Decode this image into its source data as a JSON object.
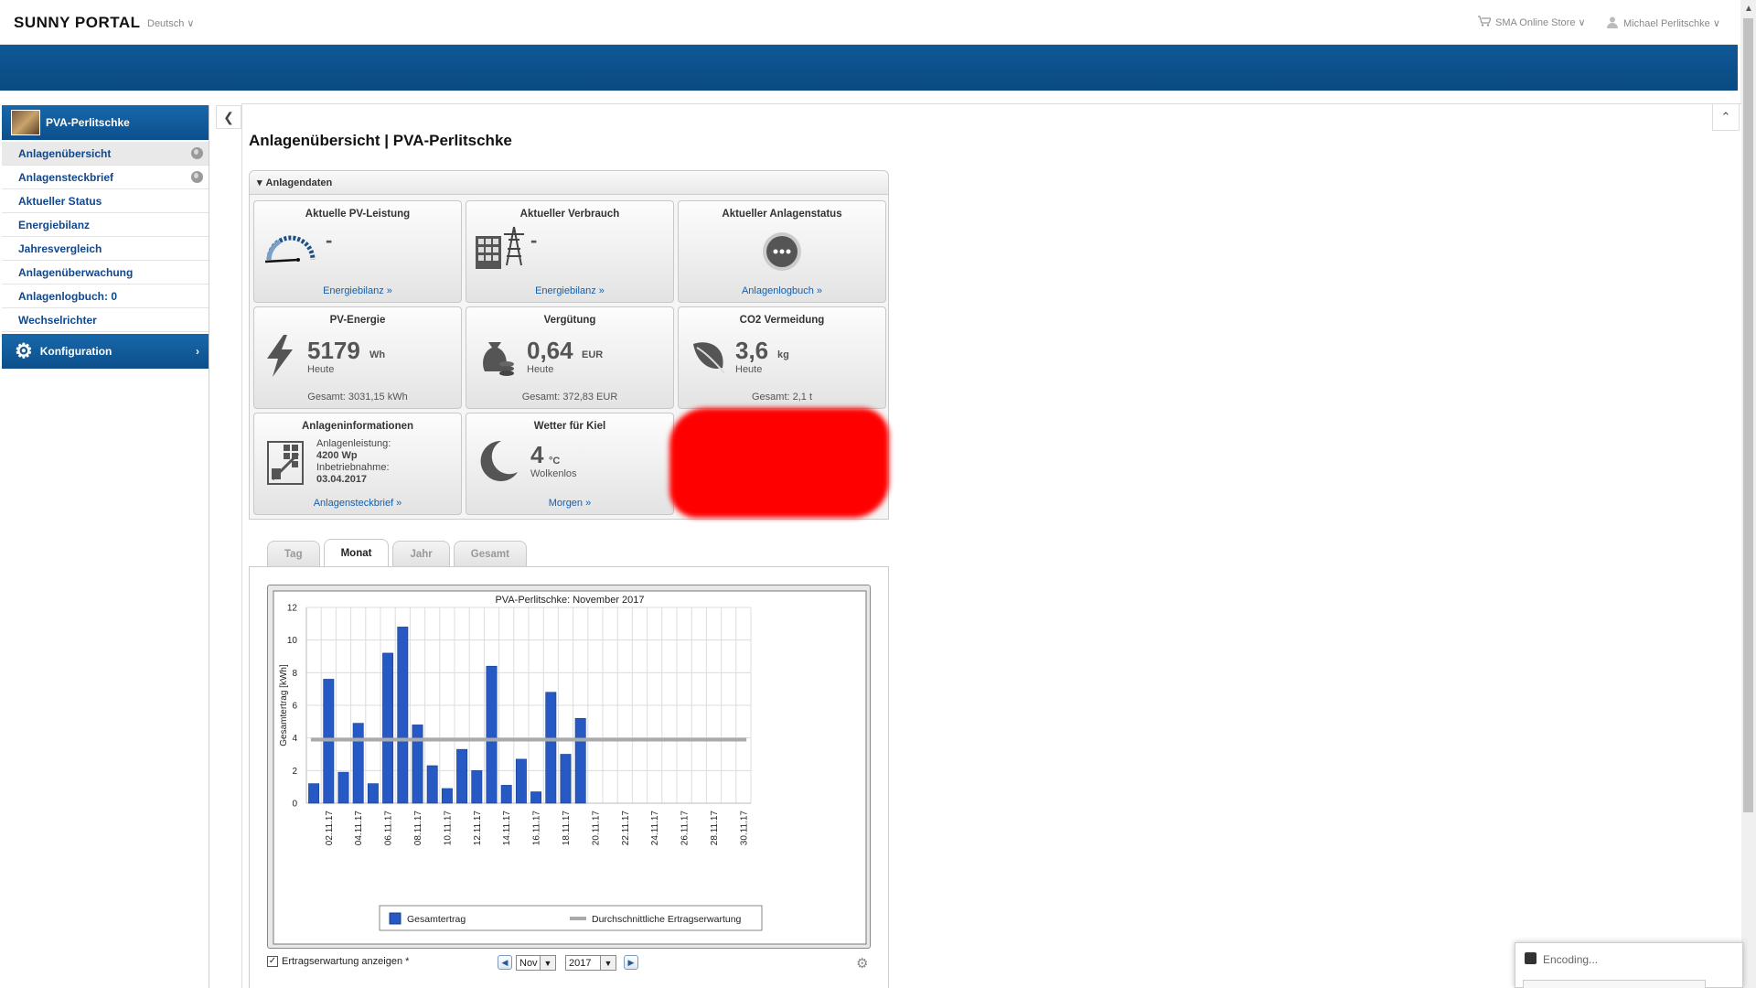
{
  "header": {
    "logo": "SUNNY PORTAL",
    "language": "Deutsch ∨",
    "store": "SMA Online Store ∨",
    "user": "Michael Perlitschke ∨"
  },
  "sidebar": {
    "plant_name": "PVA-Perlitschke",
    "items": [
      {
        "label": "Anlagenübersicht",
        "globe": true
      },
      {
        "label": "Anlagensteckbrief",
        "globe": true
      },
      {
        "label": "Aktueller Status",
        "globe": false
      },
      {
        "label": "Energiebilanz",
        "globe": false
      },
      {
        "label": "Jahresvergleich",
        "globe": false
      },
      {
        "label": "Anlagenüberwachung",
        "globe": false
      },
      {
        "label": "Anlagenlogbuch: 0",
        "globe": false
      },
      {
        "label": "Wechselrichter",
        "globe": false
      }
    ],
    "config_label": "Konfiguration",
    "config_chevron": "›"
  },
  "main": {
    "title": "Anlagenübersicht | PVA-Perlitschke",
    "panel_title": "Anlagendaten",
    "tiles": {
      "pv_power": {
        "title": "Aktuelle PV-Leistung",
        "value": "-",
        "link": "Energiebilanz »"
      },
      "consumption": {
        "title": "Aktueller Verbrauch",
        "value": "-",
        "link": "Energiebilanz »"
      },
      "status": {
        "title": "Aktueller Anlagenstatus",
        "link": "Anlagenlogbuch »"
      },
      "pv_energy": {
        "title": "PV-Energie",
        "value": "5179",
        "unit": "Wh",
        "sub": "Heute",
        "total": "Gesamt: 3031,15 kWh"
      },
      "payment": {
        "title": "Vergütung",
        "value": "0,64",
        "unit": "EUR",
        "sub": "Heute",
        "total": "Gesamt: 372,83 EUR"
      },
      "co2": {
        "title": "CO2 Vermeidung",
        "value": "3,6",
        "unit": "kg",
        "sub": "Heute",
        "total": "Gesamt: 2,1 t"
      },
      "info": {
        "title": "Anlageninformationen",
        "line1": "Anlagenleistung:",
        "line2": "4200 Wp",
        "line3": "Inbetriebnahme:",
        "line4": "03.04.2017",
        "link": "Anlagensteckbrief »"
      },
      "weather": {
        "title": "Wetter für Kiel",
        "value": "4",
        "unit": "°C",
        "sub": "Wolkenlos",
        "link": "Morgen »"
      }
    },
    "tabs": [
      {
        "label": "Tag",
        "active": false
      },
      {
        "label": "Monat",
        "active": true
      },
      {
        "label": "Jahr",
        "active": false
      },
      {
        "label": "Gesamt",
        "active": false
      }
    ],
    "controls": {
      "checkbox_label": "Ertragserwartung anzeigen *",
      "checked": true,
      "month": "Nov",
      "year": "2017"
    }
  },
  "chart_data": {
    "type": "bar",
    "title": "PVA-Perlitschke: November 2017",
    "ylabel": "Gesamtertrag [kWh]",
    "xlabel": "",
    "ylim": [
      0,
      12
    ],
    "yticks": [
      0,
      2,
      4,
      6,
      8,
      10,
      12
    ],
    "x": [
      "01.11.17",
      "02.11.17",
      "03.11.17",
      "04.11.17",
      "05.11.17",
      "06.11.17",
      "07.11.17",
      "08.11.17",
      "09.11.17",
      "10.11.17",
      "11.11.17",
      "12.11.17",
      "13.11.17",
      "14.11.17",
      "15.11.17",
      "16.11.17",
      "17.11.17",
      "18.11.17",
      "19.11.17",
      "20.11.17",
      "21.11.17",
      "22.11.17",
      "23.11.17",
      "24.11.17",
      "25.11.17",
      "26.11.17",
      "27.11.17",
      "28.11.17",
      "29.11.17",
      "30.11.17"
    ],
    "xtick_labels": [
      "02.11.17",
      "04.11.17",
      "06.11.17",
      "08.11.17",
      "10.11.17",
      "12.11.17",
      "14.11.17",
      "16.11.17",
      "18.11.17",
      "20.11.17",
      "22.11.17",
      "24.11.17",
      "26.11.17",
      "28.11.17",
      "30.11.17"
    ],
    "series": [
      {
        "name": "Gesamtertrag",
        "color": "#2659c4",
        "values": [
          1.2,
          7.6,
          1.9,
          4.9,
          1.2,
          9.2,
          10.8,
          4.8,
          2.3,
          0.9,
          3.3,
          2.0,
          8.4,
          1.1,
          2.7,
          0.7,
          6.8,
          3.0,
          5.2,
          null,
          null,
          null,
          null,
          null,
          null,
          null,
          null,
          null,
          null,
          null
        ]
      },
      {
        "name": "Durchschnittliche Ertragserwartung",
        "color": "#a9a9a9",
        "constant": 3.9
      }
    ],
    "legend_position": "bottom",
    "grid": true
  },
  "status_popup": {
    "label": "Encoding..."
  }
}
